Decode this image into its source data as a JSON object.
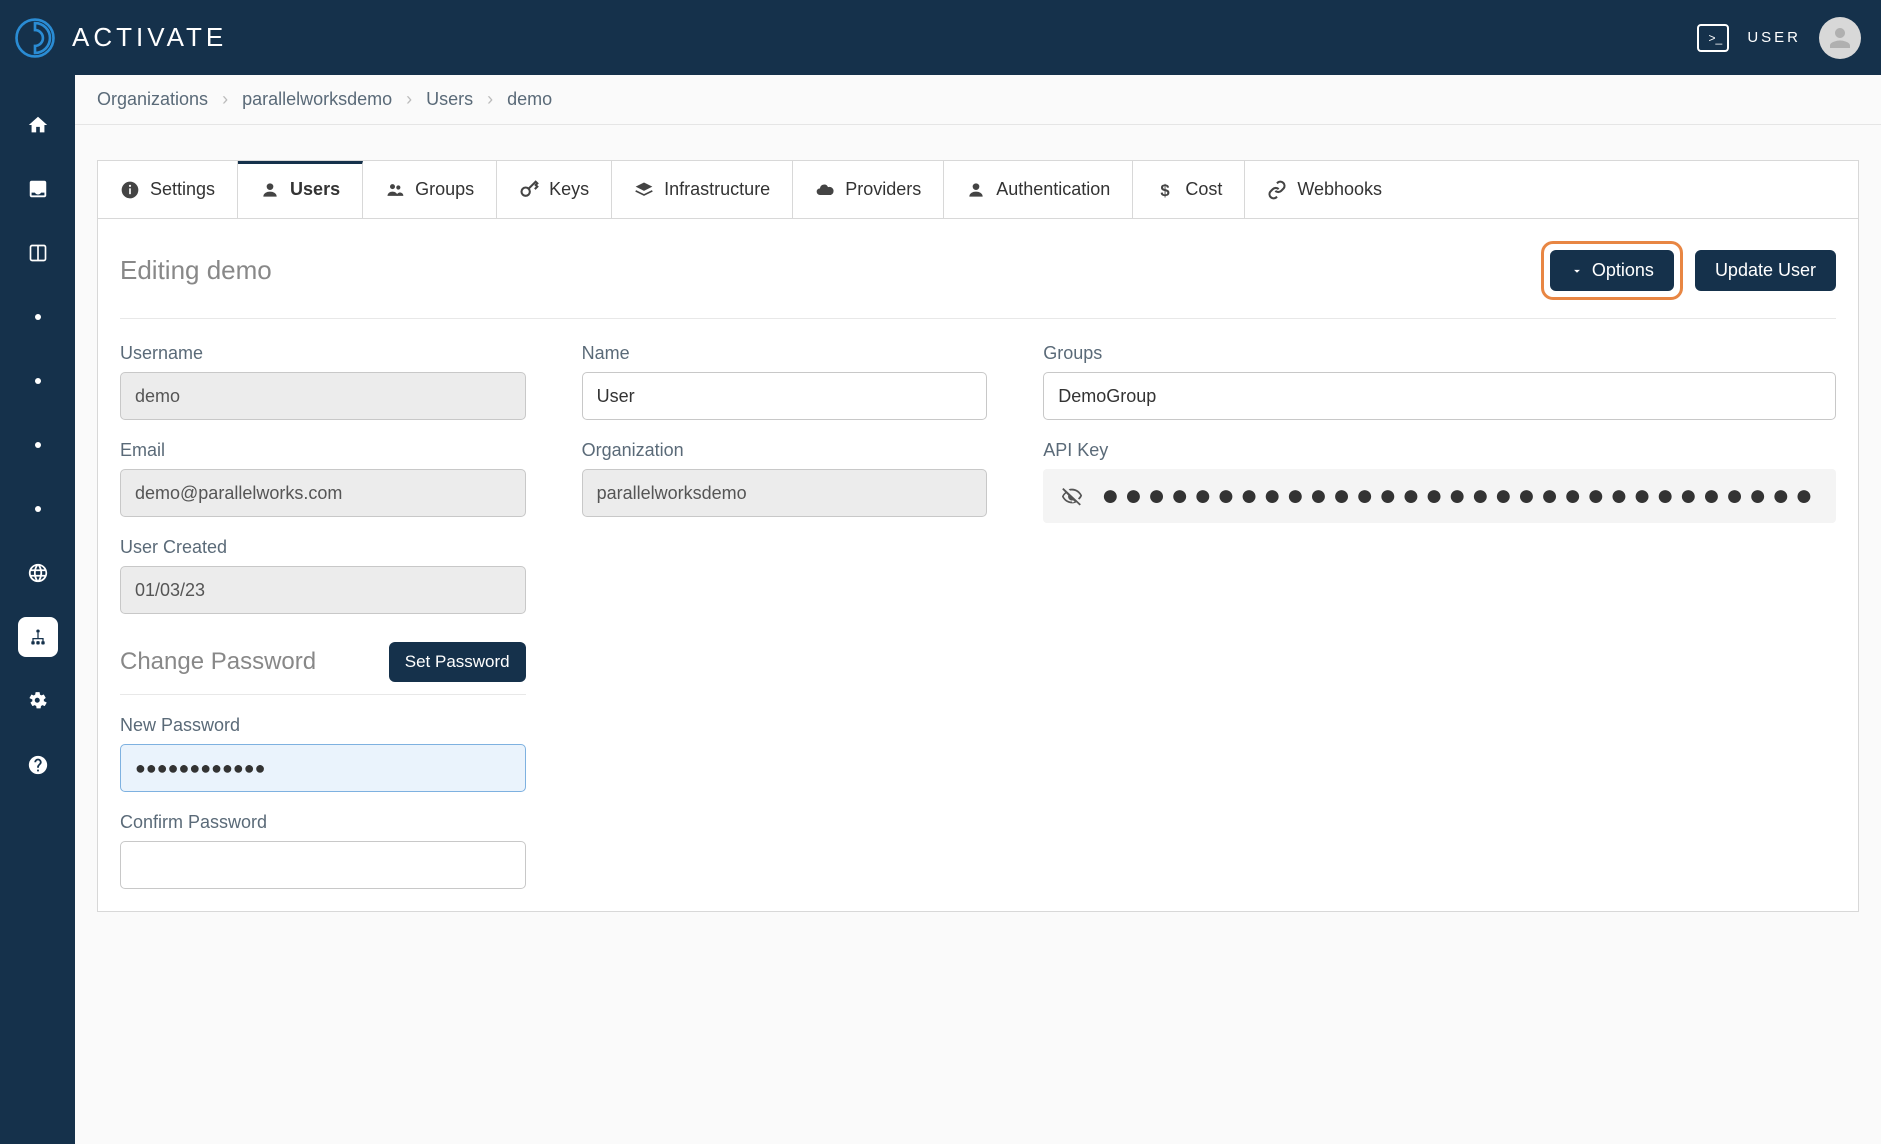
{
  "header": {
    "brand": "ACTIVATE",
    "user_label": "USER"
  },
  "breadcrumb": {
    "items": [
      "Organizations",
      "parallelworksdemo",
      "Users",
      "demo"
    ]
  },
  "tabs": [
    {
      "label": "Settings"
    },
    {
      "label": "Users"
    },
    {
      "label": "Groups"
    },
    {
      "label": "Keys"
    },
    {
      "label": "Infrastructure"
    },
    {
      "label": "Providers"
    },
    {
      "label": "Authentication"
    },
    {
      "label": "Cost"
    },
    {
      "label": "Webhooks"
    }
  ],
  "panel": {
    "title": "Editing demo",
    "options_label": "Options",
    "update_label": "Update User"
  },
  "form": {
    "username_label": "Username",
    "username_value": "demo",
    "email_label": "Email",
    "email_value": "demo@parallelworks.com",
    "created_label": "User Created",
    "created_value": "01/03/23",
    "name_label": "Name",
    "name_value": "User",
    "org_label": "Organization",
    "org_value": "parallelworksdemo",
    "groups_label": "Groups",
    "groups_value": "DemoGroup",
    "apikey_label": "API Key",
    "apikey_masked": "●●●●●●●●●●●●●●●●●●●●●●●●●●●●●●●"
  },
  "password": {
    "section_title": "Change Password",
    "set_label": "Set Password",
    "new_label": "New Password",
    "new_value": "●●●●●●●●●●●●",
    "confirm_label": "Confirm Password",
    "confirm_value": ""
  }
}
